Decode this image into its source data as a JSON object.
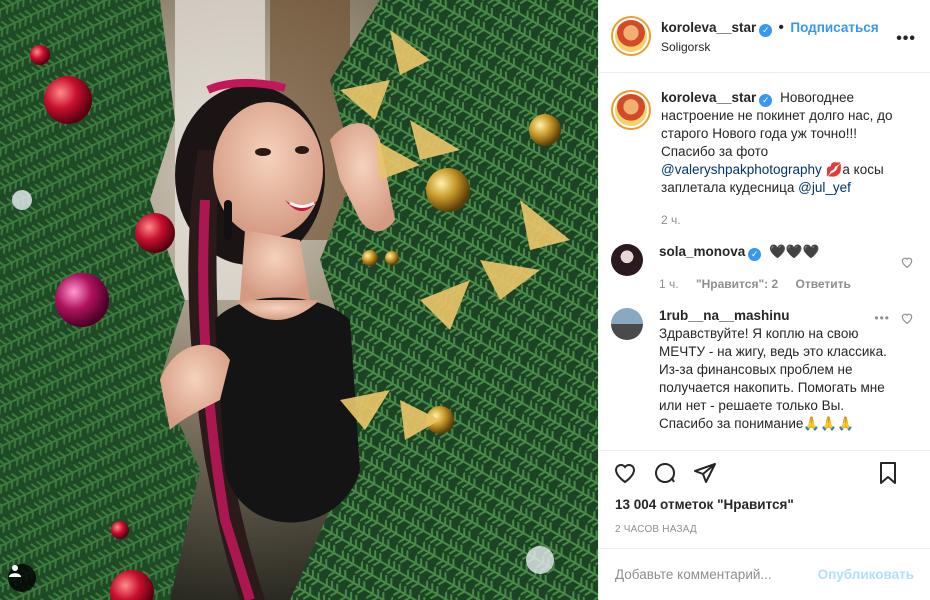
{
  "post": {
    "username": "koroleva__star",
    "follow_label": "Подписаться",
    "dot": "•",
    "location": "Soligorsk",
    "more_label": "•••"
  },
  "caption": {
    "username": "koroleva__star",
    "text_1": "Новогоднее настроение не покинет долго нас, до старого Нового года уж точно!!! Спасибо за фото ",
    "mention_1": "@valeryshpakphotography",
    "text_2": " 💋а косы заплетала кудесница ",
    "mention_2": "@jul_yef",
    "time": "2 ч."
  },
  "comments": [
    {
      "username": "sola_monova",
      "text": "🖤🖤🖤",
      "time": "1 ч.",
      "likes": "\"Нравится\": 2",
      "reply": "Ответить"
    },
    {
      "username": "1rub__na__mashinu",
      "text": "Здравствуйте! Я коплю на свою МЕЧТУ - на жигу, ведь это классика. Из-за финансовых проблем не получается накопить. Помогать мне или нет - решаете только Вы. Спасибо за понимание🙏🙏🙏",
      "more": "•••"
    }
  ],
  "stats": {
    "likes": "13 004 отметок \"Нравится\"",
    "time": "2 ЧАСОВ НАЗАД"
  },
  "add_comment": {
    "placeholder": "Добавьте комментарий...",
    "publish": "Опубликовать"
  },
  "colors": {
    "accent": "#3897f0",
    "publish_disabled": "#b2dffc",
    "muted": "#8e8e8e"
  }
}
